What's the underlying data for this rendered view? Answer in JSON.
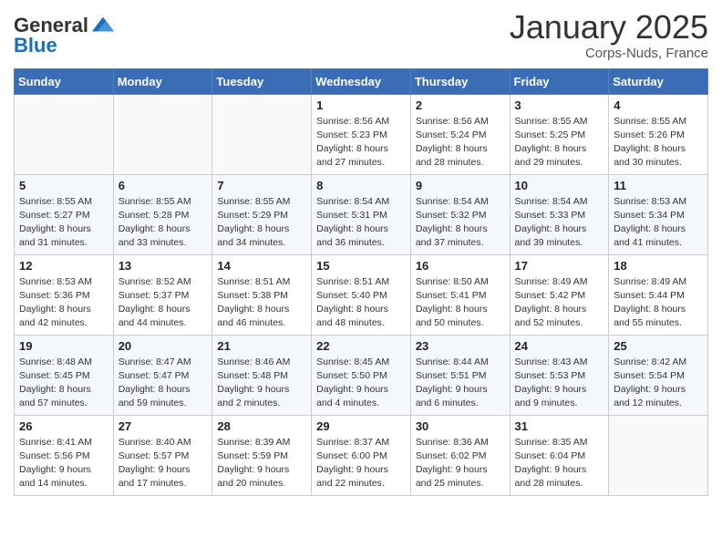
{
  "header": {
    "logo_general": "General",
    "logo_blue": "Blue",
    "month": "January 2025",
    "location": "Corps-Nuds, France"
  },
  "days_of_week": [
    "Sunday",
    "Monday",
    "Tuesday",
    "Wednesday",
    "Thursday",
    "Friday",
    "Saturday"
  ],
  "weeks": [
    [
      {
        "day": "",
        "info": ""
      },
      {
        "day": "",
        "info": ""
      },
      {
        "day": "",
        "info": ""
      },
      {
        "day": "1",
        "info": "Sunrise: 8:56 AM\nSunset: 5:23 PM\nDaylight: 8 hours and 27 minutes."
      },
      {
        "day": "2",
        "info": "Sunrise: 8:56 AM\nSunset: 5:24 PM\nDaylight: 8 hours and 28 minutes."
      },
      {
        "day": "3",
        "info": "Sunrise: 8:55 AM\nSunset: 5:25 PM\nDaylight: 8 hours and 29 minutes."
      },
      {
        "day": "4",
        "info": "Sunrise: 8:55 AM\nSunset: 5:26 PM\nDaylight: 8 hours and 30 minutes."
      }
    ],
    [
      {
        "day": "5",
        "info": "Sunrise: 8:55 AM\nSunset: 5:27 PM\nDaylight: 8 hours and 31 minutes."
      },
      {
        "day": "6",
        "info": "Sunrise: 8:55 AM\nSunset: 5:28 PM\nDaylight: 8 hours and 33 minutes."
      },
      {
        "day": "7",
        "info": "Sunrise: 8:55 AM\nSunset: 5:29 PM\nDaylight: 8 hours and 34 minutes."
      },
      {
        "day": "8",
        "info": "Sunrise: 8:54 AM\nSunset: 5:31 PM\nDaylight: 8 hours and 36 minutes."
      },
      {
        "day": "9",
        "info": "Sunrise: 8:54 AM\nSunset: 5:32 PM\nDaylight: 8 hours and 37 minutes."
      },
      {
        "day": "10",
        "info": "Sunrise: 8:54 AM\nSunset: 5:33 PM\nDaylight: 8 hours and 39 minutes."
      },
      {
        "day": "11",
        "info": "Sunrise: 8:53 AM\nSunset: 5:34 PM\nDaylight: 8 hours and 41 minutes."
      }
    ],
    [
      {
        "day": "12",
        "info": "Sunrise: 8:53 AM\nSunset: 5:36 PM\nDaylight: 8 hours and 42 minutes."
      },
      {
        "day": "13",
        "info": "Sunrise: 8:52 AM\nSunset: 5:37 PM\nDaylight: 8 hours and 44 minutes."
      },
      {
        "day": "14",
        "info": "Sunrise: 8:51 AM\nSunset: 5:38 PM\nDaylight: 8 hours and 46 minutes."
      },
      {
        "day": "15",
        "info": "Sunrise: 8:51 AM\nSunset: 5:40 PM\nDaylight: 8 hours and 48 minutes."
      },
      {
        "day": "16",
        "info": "Sunrise: 8:50 AM\nSunset: 5:41 PM\nDaylight: 8 hours and 50 minutes."
      },
      {
        "day": "17",
        "info": "Sunrise: 8:49 AM\nSunset: 5:42 PM\nDaylight: 8 hours and 52 minutes."
      },
      {
        "day": "18",
        "info": "Sunrise: 8:49 AM\nSunset: 5:44 PM\nDaylight: 8 hours and 55 minutes."
      }
    ],
    [
      {
        "day": "19",
        "info": "Sunrise: 8:48 AM\nSunset: 5:45 PM\nDaylight: 8 hours and 57 minutes."
      },
      {
        "day": "20",
        "info": "Sunrise: 8:47 AM\nSunset: 5:47 PM\nDaylight: 8 hours and 59 minutes."
      },
      {
        "day": "21",
        "info": "Sunrise: 8:46 AM\nSunset: 5:48 PM\nDaylight: 9 hours and 2 minutes."
      },
      {
        "day": "22",
        "info": "Sunrise: 8:45 AM\nSunset: 5:50 PM\nDaylight: 9 hours and 4 minutes."
      },
      {
        "day": "23",
        "info": "Sunrise: 8:44 AM\nSunset: 5:51 PM\nDaylight: 9 hours and 6 minutes."
      },
      {
        "day": "24",
        "info": "Sunrise: 8:43 AM\nSunset: 5:53 PM\nDaylight: 9 hours and 9 minutes."
      },
      {
        "day": "25",
        "info": "Sunrise: 8:42 AM\nSunset: 5:54 PM\nDaylight: 9 hours and 12 minutes."
      }
    ],
    [
      {
        "day": "26",
        "info": "Sunrise: 8:41 AM\nSunset: 5:56 PM\nDaylight: 9 hours and 14 minutes."
      },
      {
        "day": "27",
        "info": "Sunrise: 8:40 AM\nSunset: 5:57 PM\nDaylight: 9 hours and 17 minutes."
      },
      {
        "day": "28",
        "info": "Sunrise: 8:39 AM\nSunset: 5:59 PM\nDaylight: 9 hours and 20 minutes."
      },
      {
        "day": "29",
        "info": "Sunrise: 8:37 AM\nSunset: 6:00 PM\nDaylight: 9 hours and 22 minutes."
      },
      {
        "day": "30",
        "info": "Sunrise: 8:36 AM\nSunset: 6:02 PM\nDaylight: 9 hours and 25 minutes."
      },
      {
        "day": "31",
        "info": "Sunrise: 8:35 AM\nSunset: 6:04 PM\nDaylight: 9 hours and 28 minutes."
      },
      {
        "day": "",
        "info": ""
      }
    ]
  ]
}
